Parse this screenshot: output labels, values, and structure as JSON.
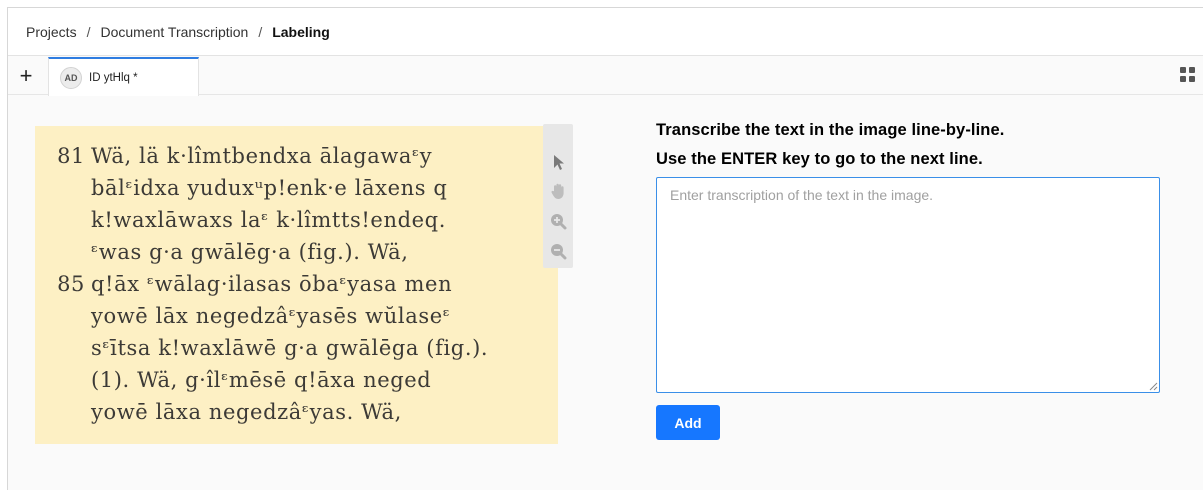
{
  "breadcrumb": {
    "items": [
      "Projects",
      "Document Transcription",
      "Labeling"
    ],
    "separator": "/"
  },
  "tabs": {
    "add_label": "+",
    "active": {
      "avatar": "AD",
      "label": "ID ytHlq *"
    }
  },
  "image": {
    "lines": [
      {
        "num": "81",
        "text": "Wä,  lä  k·lîmtbendxa  ālagawaᵋy"
      },
      {
        "num": "",
        "text": "bālᵋidxa yuduxᵘp!enk·e lāxens q"
      },
      {
        "num": "",
        "text": "k!waxlāwaxs laᵋ  k·lîmtts!endeq."
      },
      {
        "num": "",
        "text": "ᵋwas  g·a  gwālēg·a  (fig.).   Wä,"
      },
      {
        "num": "85",
        "text": "q!āx  ᵋwālag·ilasas  ōbaᵋyasa  men"
      },
      {
        "num": "",
        "text": "yowē  lāx  negedzâᵋyasēs  wŭlaseᵋ"
      },
      {
        "num": "",
        "text": "sᵋītsa k!waxlāwē g·a gwālēga (fig.)."
      },
      {
        "num": "",
        "text": "(1).   Wä,  g·îlᵋmēsē  q!āxa  neged"
      },
      {
        "num": "",
        "text": "yowē  lāxa  negedzâᵋyas.   Wä,"
      }
    ],
    "tools": [
      "cursor-icon",
      "hand-icon",
      "zoom-in-icon",
      "zoom-out-icon"
    ]
  },
  "instructions": {
    "line1": "Transcribe the text in the image line-by-line.",
    "line2": "Use the ENTER key to go to the next line."
  },
  "transcription": {
    "value": "",
    "placeholder": "Enter transcription of the text in the image."
  },
  "add_button": {
    "label": "Add"
  },
  "colors": {
    "accent": "#1677ff",
    "tab_indicator": "#2f7de1",
    "paper": "#fdf0c4"
  }
}
